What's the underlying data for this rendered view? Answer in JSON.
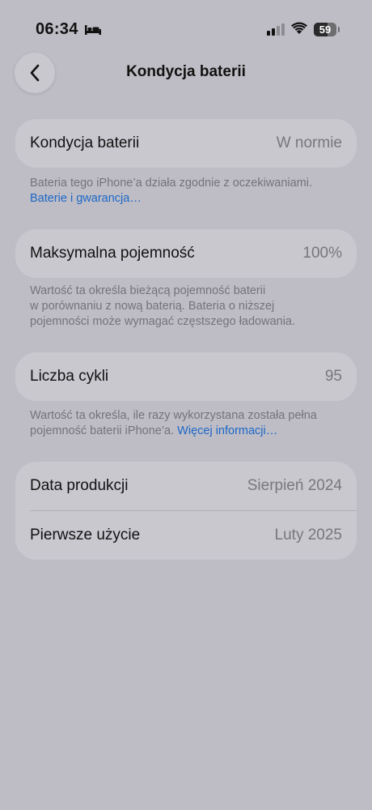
{
  "status_bar": {
    "time": "06:34",
    "battery_percent": "59"
  },
  "header": {
    "title": "Kondycja baterii"
  },
  "battery_health": {
    "label": "Kondycja baterii",
    "value": "W normie",
    "note": "Bateria tego iPhone’a działa zgodnie z oczekiwaniami.",
    "link": "Baterie i gwarancja…"
  },
  "max_capacity": {
    "label": "Maksymalna pojemność",
    "value": "100%",
    "note_lines": [
      "Wartość ta określa bieżącą pojemność baterii",
      "w porównaniu z nową baterią. Bateria o niższej",
      "pojemności może wymagać częstszego ładowania."
    ]
  },
  "cycle_count": {
    "label": "Liczba cykli",
    "value": "95",
    "note_line1": "Wartość ta określa, ile razy wykorzystana została pełna",
    "note_line2": "pojemność baterii iPhone’a.",
    "link": "Więcej informacji…"
  },
  "dates": {
    "manufacture_label": "Data produkcji",
    "manufacture_value": "Sierpień 2024",
    "first_use_label": "Pierwsze użycie",
    "first_use_value": "Luty 2025"
  },
  "colors": {
    "background": "#bebdc5",
    "card": "#c9c8cf",
    "link": "#1c67c7",
    "secondary_text": "#78777c"
  }
}
